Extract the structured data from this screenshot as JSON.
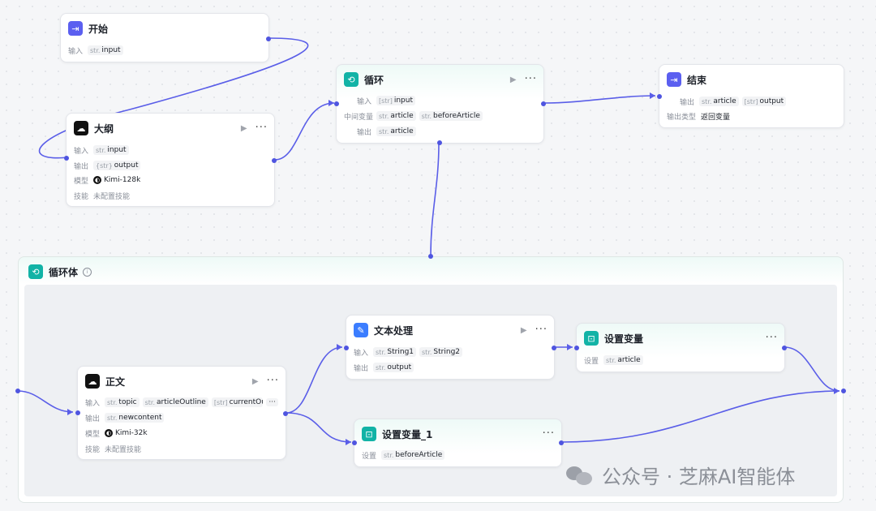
{
  "colors": {
    "edge": "#5a5ee8",
    "purple": "#5b5ff0",
    "teal": "#12b3a6",
    "blue": "#3b7dff"
  },
  "nodes": {
    "start": {
      "title": "开始",
      "icon": "enter-icon",
      "input_label": "输入",
      "input_type": "str.",
      "input_name": "input"
    },
    "outline": {
      "title": "大纲",
      "icon": "model-icon",
      "input_label": "输入",
      "input_type": "str.",
      "input_name": "input",
      "output_label": "输出",
      "output_type": "{str}",
      "output_name": "output",
      "model_label": "模型",
      "model_name": "Kimi-128k",
      "skill_label": "技能",
      "skill_value": "未配置技能"
    },
    "loop": {
      "title": "循环",
      "icon": "loop-icon",
      "input_label": "输入",
      "input_type": "[str]",
      "input_name": "input",
      "mid_label": "中间变量",
      "mid_type1": "str.",
      "mid_name1": "article",
      "mid_type2": "str.",
      "mid_name2": "beforeArticle",
      "output_label": "输出",
      "output_type": "str.",
      "output_name": "article"
    },
    "end": {
      "title": "结束",
      "icon": "exit-icon",
      "output_label": "输出",
      "output_type1": "str.",
      "output_name1": "article",
      "output_type2": "[str]",
      "output_name2": "output",
      "output_kind_label": "输出类型",
      "output_kind_value": "返回变量"
    },
    "loopbody": {
      "title": "循环体",
      "icon": "loop-icon"
    },
    "body": {
      "title": "正文",
      "icon": "model-icon",
      "input_label": "输入",
      "t1": "str.",
      "n1": "topic",
      "t2": "str.",
      "n2": "articleOutline",
      "t3": "[str]",
      "n3": "currentOut",
      "more": "···",
      "output_label": "输出",
      "output_type": "str.",
      "output_name": "newcontent",
      "model_label": "模型",
      "model_name": "Kimi-32k",
      "skill_label": "技能",
      "skill_value": "未配置技能"
    },
    "text": {
      "title": "文本处理",
      "icon": "text-process-icon",
      "input_label": "输入",
      "t1": "str.",
      "n1": "String1",
      "t2": "str.",
      "n2": "String2",
      "output_label": "输出",
      "output_type": "str.",
      "output_name": "output"
    },
    "setvar": {
      "title": "设置变量",
      "icon": "set-variable-icon",
      "set_label": "设置",
      "set_type": "str.",
      "set_name": "article"
    },
    "setvar1": {
      "title": "设置变量_1",
      "icon": "set-variable-icon",
      "set_label": "设置",
      "set_type": "str.",
      "set_name": "beforeArticle"
    }
  },
  "watermark": {
    "text": "公众号 · 芝麻AI智能体"
  }
}
